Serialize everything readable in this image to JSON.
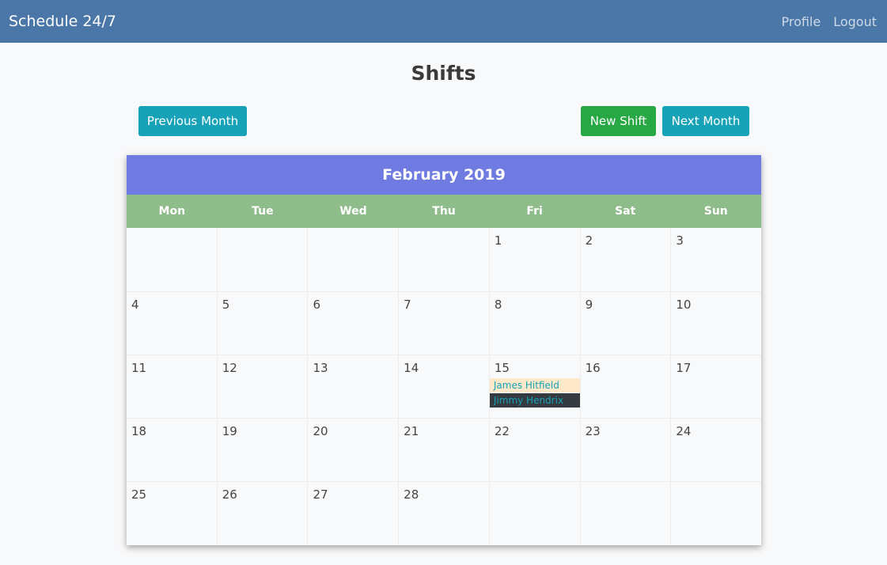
{
  "navbar": {
    "brand": "Schedule 24/7",
    "links": [
      "Profile",
      "Logout"
    ]
  },
  "page": {
    "title": "Shifts",
    "prev_label": "Previous Month",
    "new_label": "New Shift",
    "next_label": "Next Month"
  },
  "calendar": {
    "month_label": "February 2019",
    "weekdays": [
      "Mon",
      "Tue",
      "Wed",
      "Thu",
      "Fri",
      "Sat",
      "Sun"
    ],
    "weeks": [
      [
        "",
        "",
        "",
        "",
        "1",
        "2",
        "3"
      ],
      [
        "4",
        "5",
        "6",
        "7",
        "8",
        "9",
        "10"
      ],
      [
        "11",
        "12",
        "13",
        "14",
        "15",
        "16",
        "17"
      ],
      [
        "18",
        "19",
        "20",
        "21",
        "22",
        "23",
        "24"
      ],
      [
        "25",
        "26",
        "27",
        "28",
        "",
        "",
        ""
      ]
    ],
    "shifts": {
      "15": [
        "James Hitfield",
        "Jimmy Hendrix"
      ]
    }
  },
  "colors": {
    "navbar": "#4a76a8",
    "calendar_header": "#6f7be0",
    "weekday_row": "#8fbc8b",
    "info_button": "#17a2b8",
    "success_button": "#28a745"
  }
}
